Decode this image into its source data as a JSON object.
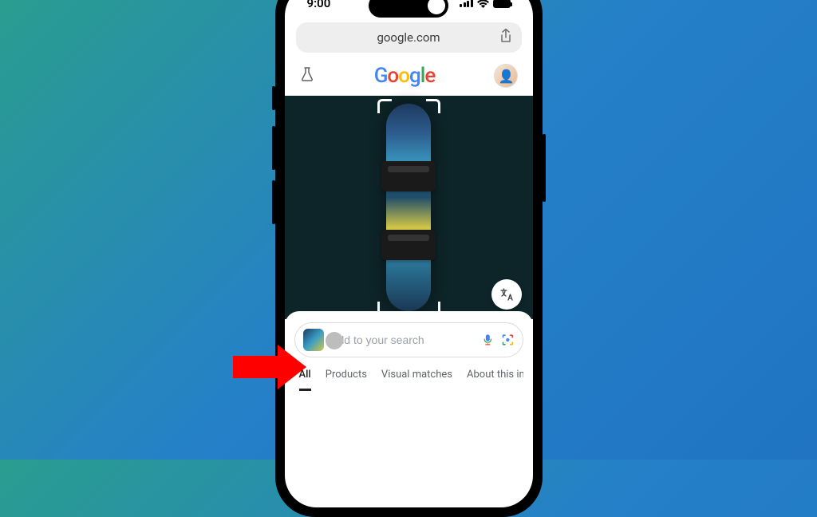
{
  "status": {
    "time": "9:00"
  },
  "browser": {
    "url": "google.com"
  },
  "header": {
    "logoText": "Google"
  },
  "lens": {
    "searchPlaceholder": "Add to your search",
    "tabs": [
      "All",
      "Products",
      "Visual matches",
      "About this image"
    ]
  }
}
